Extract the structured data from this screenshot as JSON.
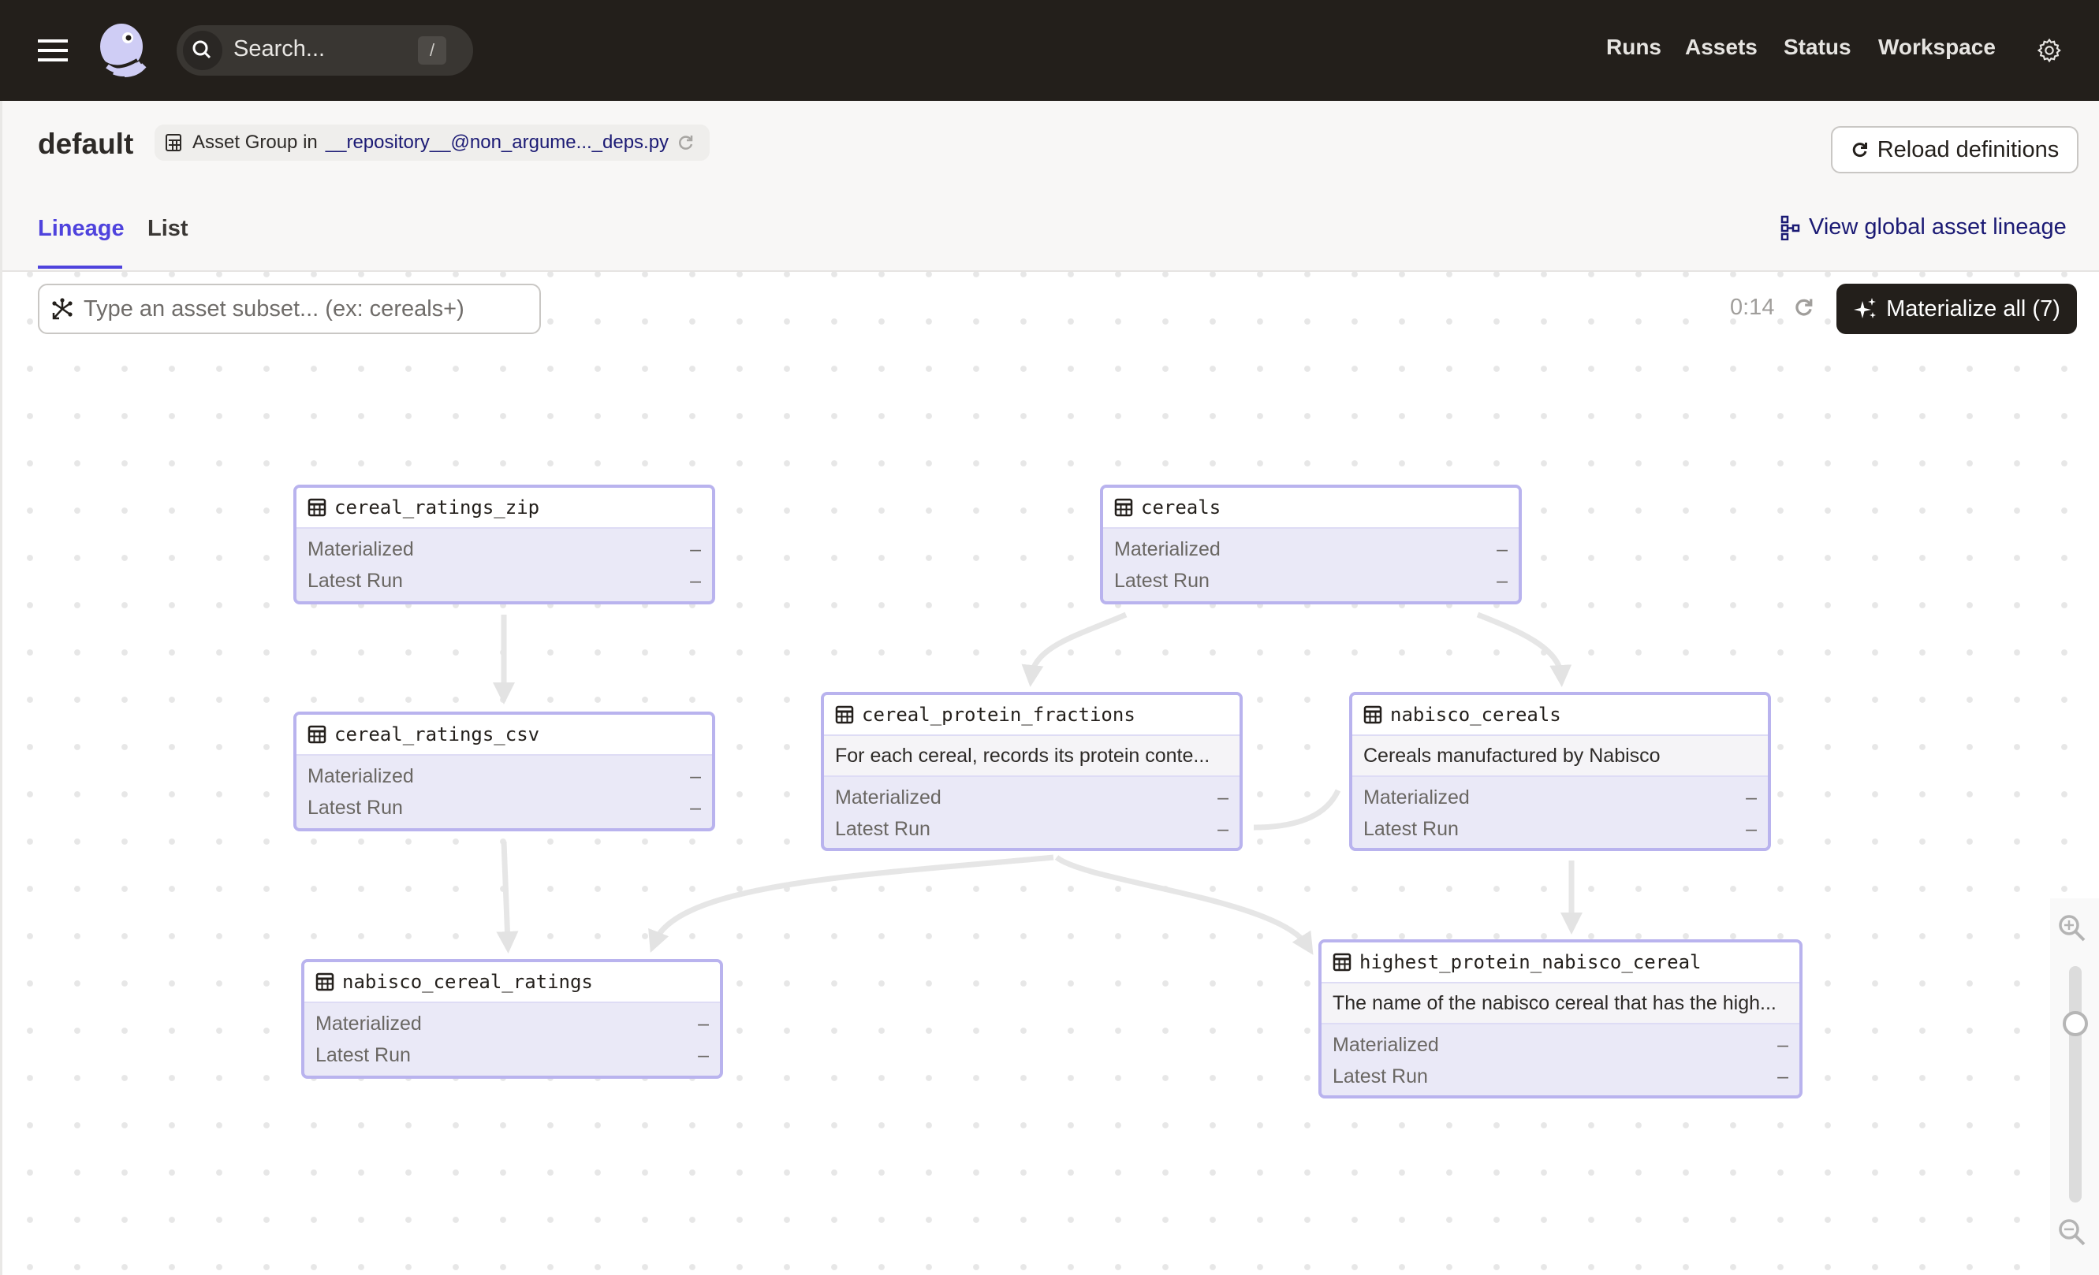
{
  "topbar": {
    "search_placeholder": "Search...",
    "search_shortcut": "/",
    "nav": [
      {
        "label": "Runs"
      },
      {
        "label": "Assets"
      },
      {
        "label": "Status"
      },
      {
        "label": "Workspace"
      }
    ],
    "icons": {
      "menu": "hamburger-icon",
      "logo": "dagster-logo",
      "search": "search-icon",
      "settings": "gear-icon"
    }
  },
  "header": {
    "title": "default",
    "group_prefix": "Asset Group in",
    "repo_link": "__repository__@non_argume..._deps.py",
    "reload_button": "Reload definitions",
    "tabs": [
      {
        "label": "Lineage",
        "active": true
      },
      {
        "label": "List",
        "active": false
      }
    ],
    "global_lineage_link": "View global asset lineage"
  },
  "toolbar": {
    "subset_placeholder": "Type an asset subset... (ex: cereals+)",
    "refresh_timer": "0:14",
    "materialize_button": "Materialize all (7)"
  },
  "graph": {
    "row_labels": {
      "materialized": "Materialized",
      "latest_run": "Latest Run"
    },
    "nodes": [
      {
        "id": "cereal_ratings_zip",
        "name": "cereal_ratings_zip",
        "description": null,
        "materialized": "–",
        "latest_run": "–"
      },
      {
        "id": "cereals",
        "name": "cereals",
        "description": null,
        "materialized": "–",
        "latest_run": "–"
      },
      {
        "id": "cereal_ratings_csv",
        "name": "cereal_ratings_csv",
        "description": null,
        "materialized": "–",
        "latest_run": "–"
      },
      {
        "id": "cereal_protein_fractions",
        "name": "cereal_protein_fractions",
        "description": "For each cereal, records its protein conte...",
        "materialized": "–",
        "latest_run": "–"
      },
      {
        "id": "nabisco_cereals",
        "name": "nabisco_cereals",
        "description": "Cereals manufactured by Nabisco",
        "materialized": "–",
        "latest_run": "–"
      },
      {
        "id": "nabisco_cereal_ratings",
        "name": "nabisco_cereal_ratings",
        "description": null,
        "materialized": "–",
        "latest_run": "–"
      },
      {
        "id": "highest_protein_nabisco_cereal",
        "name": "highest_protein_nabisco_cereal",
        "description": "The name of the nabisco cereal that has the high...",
        "materialized": "–",
        "latest_run": "–"
      }
    ],
    "edges": [
      {
        "from": "cereal_ratings_zip",
        "to": "cereal_ratings_csv"
      },
      {
        "from": "cereals",
        "to": "cereal_protein_fractions"
      },
      {
        "from": "cereals",
        "to": "nabisco_cereals"
      },
      {
        "from": "cereal_ratings_csv",
        "to": "nabisco_cereal_ratings"
      },
      {
        "from": "nabisco_cereals",
        "to": "nabisco_cereal_ratings"
      },
      {
        "from": "cereal_protein_fractions",
        "to": "highest_protein_nabisco_cereal"
      },
      {
        "from": "nabisco_cereals",
        "to": "highest_protein_nabisco_cereal"
      }
    ]
  },
  "zoom_control": {
    "level_fraction": 0.81
  },
  "colors": {
    "accent": "#4f43dd",
    "link": "#1b1a74",
    "topbar_bg": "#231f1b",
    "node_border": "#b9b3ee",
    "node_body": "#eae9f7",
    "edge": "#e6e6e6"
  }
}
